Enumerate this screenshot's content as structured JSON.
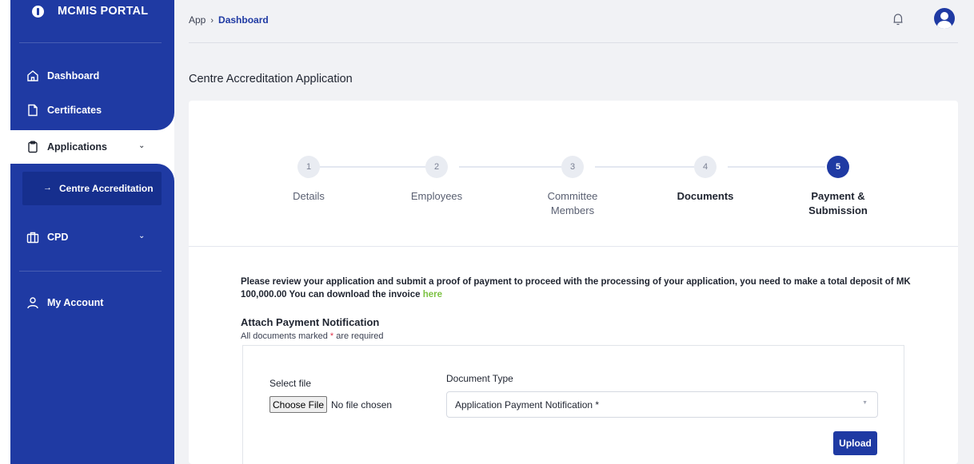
{
  "brand": {
    "title": "MCMIS PORTAL"
  },
  "sidebar": {
    "items": [
      {
        "label": "Dashboard",
        "icon": "home-icon"
      },
      {
        "label": "Certificates",
        "icon": "file-icon"
      },
      {
        "label": "Applications",
        "icon": "clipboard-icon",
        "chevron": "chevron-down-icon"
      },
      {
        "label": "Centre Accreditation",
        "icon": "arrow-right-icon"
      },
      {
        "label": "CPD",
        "icon": "briefcase-icon",
        "chevron": "chevron-down-icon"
      },
      {
        "label": "My Account",
        "icon": "user-icon"
      }
    ]
  },
  "header": {
    "breadcrumb": {
      "root": "App",
      "current": "Dashboard"
    }
  },
  "page": {
    "title": "Centre Accreditation Application"
  },
  "stepper": {
    "steps": [
      {
        "number": "1",
        "label_line1": "Details",
        "label_line2": ""
      },
      {
        "number": "2",
        "label_line1": "Employees",
        "label_line2": ""
      },
      {
        "number": "3",
        "label_line1": "Committee",
        "label_line2": "Members"
      },
      {
        "number": "4",
        "label_line1": "Documents",
        "label_line2": ""
      },
      {
        "number": "5",
        "label_line1": "Payment &",
        "label_line2": "Submission"
      }
    ],
    "active_step": 5
  },
  "payment": {
    "notice": "Please review your application and submit a proof of payment to proceed with the processing of your application, you need to make a total deposit of MK 100,000.00 You can download the invoice ",
    "link_text": "here",
    "attach_title": "Attach Payment Notification",
    "req_prefix": "All documents marked ",
    "req_star": "*",
    "req_suffix": " are required"
  },
  "upload": {
    "select_label": "Select file",
    "choose_button": "Choose File",
    "no_file": "No file chosen",
    "doc_type_label": "Document Type",
    "doc_type_value": "Application Payment Notification *",
    "upload_button": "Upload"
  },
  "colors": {
    "primary": "#1f3aa3",
    "link": "#7cc242",
    "required": "#e0334a"
  }
}
